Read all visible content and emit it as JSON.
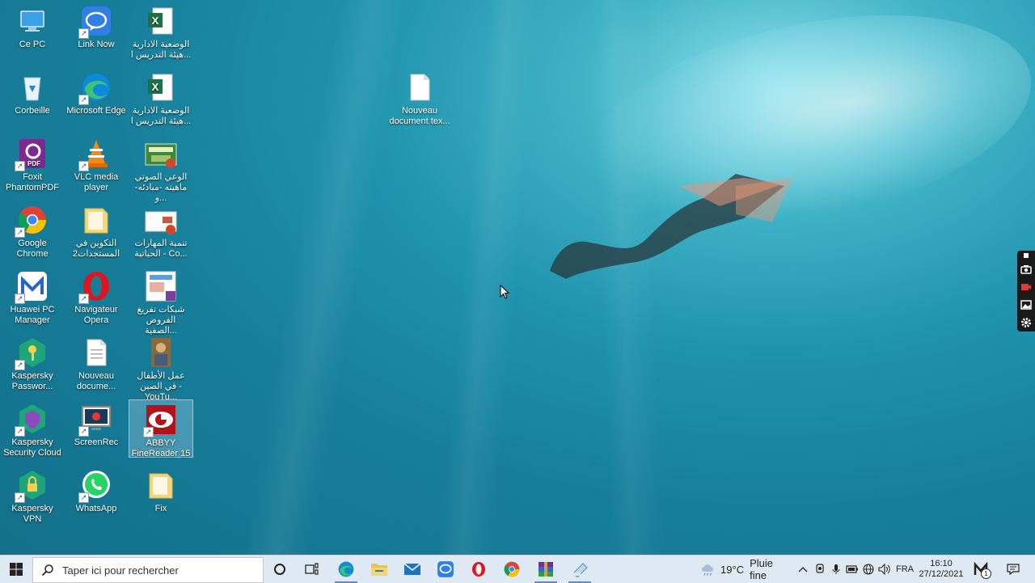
{
  "desktop": {
    "icons": [
      {
        "id": "ce-pc",
        "label": "Ce PC",
        "icon": "computer-icon"
      },
      {
        "id": "link-now",
        "label": "Link Now",
        "icon": "chat-bubble-icon"
      },
      {
        "id": "xlsx-1",
        "label": "الوضعية الادارية هيئة التدريس ا...",
        "icon": "excel-file-icon"
      },
      {
        "id": "corbeille",
        "label": "Corbeille",
        "icon": "recycle-bin-icon"
      },
      {
        "id": "edge",
        "label": "Microsoft Edge",
        "icon": "edge-icon"
      },
      {
        "id": "xlsx-2",
        "label": "الوضعية الادارية هيئة التدريس ا...",
        "icon": "excel-file-icon"
      },
      {
        "id": "nouveau-doc-txt",
        "label": "Nouveau document tex...",
        "icon": "text-file-icon"
      },
      {
        "id": "foxit",
        "label": "Foxit PhantomPDF",
        "icon": "foxit-pdf-icon"
      },
      {
        "id": "vlc",
        "label": "VLC media player",
        "icon": "vlc-cone-icon"
      },
      {
        "id": "ppt-1",
        "label": "الوعي الصوتي ماهيته -مبادئه-و...",
        "icon": "powerpoint-file-icon"
      },
      {
        "id": "chrome",
        "label": "Google Chrome",
        "icon": "chrome-icon"
      },
      {
        "id": "folder-1",
        "label": "التكوين في المستجدات2",
        "icon": "folder-icon"
      },
      {
        "id": "ppt-2",
        "label": "تنمية المهارات الحياتية - Co...",
        "icon": "powerpoint-file-icon"
      },
      {
        "id": "huawei",
        "label": "Huawei PC Manager",
        "icon": "huawei-manager-icon"
      },
      {
        "id": "opera",
        "label": "Navigateur Opera",
        "icon": "opera-icon"
      },
      {
        "id": "onenote",
        "label": "شبكات تفريغ الفروض الصفية...",
        "icon": "document-thumbnail-icon"
      },
      {
        "id": "kaspersky-pw",
        "label": "Kaspersky Passwor...",
        "icon": "kaspersky-key-icon"
      },
      {
        "id": "nouveau-doc",
        "label": "Nouveau docume...",
        "icon": "text-file-icon"
      },
      {
        "id": "youtube-shortcut",
        "label": "عمل الأطفال في الصين - YouTu...",
        "icon": "video-thumbnail-icon"
      },
      {
        "id": "kaspersky-sc",
        "label": "Kaspersky Security Cloud",
        "icon": "kaspersky-shield-icon"
      },
      {
        "id": "screenrec",
        "label": "ScreenRec",
        "icon": "screen-recorder-icon"
      },
      {
        "id": "abbyy",
        "label": "ABBYY FineReader 15",
        "icon": "abbyy-icon"
      },
      {
        "id": "kaspersky-vpn",
        "label": "Kaspersky VPN",
        "icon": "kaspersky-vpn-icon"
      },
      {
        "id": "whatsapp",
        "label": "WhatsApp",
        "icon": "whatsapp-icon"
      },
      {
        "id": "fix",
        "label": "Fix",
        "icon": "folder-icon"
      }
    ]
  },
  "taskbar": {
    "search_placeholder": "Taper ici pour rechercher",
    "weather_temp": "19°C",
    "weather_desc": "Pluie fine",
    "language": "FRA",
    "time": "16:10",
    "date": "27/12/2021",
    "notification_count": "1",
    "pinned": [
      "cortana-circle-icon",
      "task-view-icon",
      "edge-icon",
      "file-explorer-icon",
      "mail-icon",
      "link-now-icon",
      "opera-icon",
      "chrome-icon",
      "winrar-icon",
      "screenrec-icon"
    ]
  },
  "colors": {
    "taskbar_bg": "#dfe9f3",
    "selection": "#c8e6ff"
  }
}
